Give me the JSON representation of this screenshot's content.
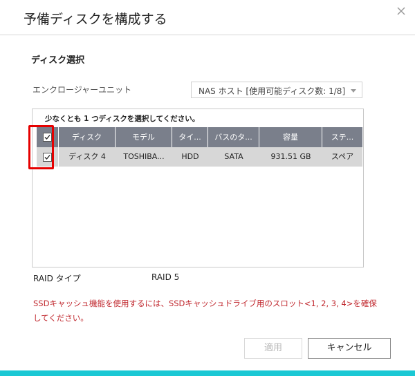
{
  "dialog": {
    "title": "予備ディスクを構成する",
    "close_icon": "close-icon"
  },
  "section": {
    "title": "ディスク選択"
  },
  "enclosure": {
    "label": "エンクロージャーユニット",
    "selected": "NAS ホスト [使用可能ディスク数: 1/8]"
  },
  "disk_panel": {
    "instruction": "少なくとも 1 つディスクを選択してください。",
    "columns": [
      "ディスク",
      "モデル",
      "タイ...",
      "バスのタ...",
      "容量",
      "ステ..."
    ],
    "rows": [
      {
        "checked": true,
        "cells": [
          "ディスク 4",
          "TOSHIBA...",
          "HDD",
          "SATA",
          "931.51 GB",
          "スペア"
        ]
      }
    ],
    "select_all_checked": true
  },
  "raid": {
    "label": "RAID タイプ",
    "value": "RAID 5"
  },
  "warning": {
    "text": "SSDキャッシュ機能を使用するには、SSDキャッシュドライブ用のスロット<1, 2, 3, 4>を確保してください。"
  },
  "buttons": {
    "apply": "適用",
    "cancel": "キャンセル"
  },
  "colors": {
    "header_bg": "#7a7f8b",
    "row_bg": "#d7d7d7",
    "warning": "#c0272d",
    "highlight": "#e60000",
    "bottom_bar": "#1bc8d4"
  }
}
